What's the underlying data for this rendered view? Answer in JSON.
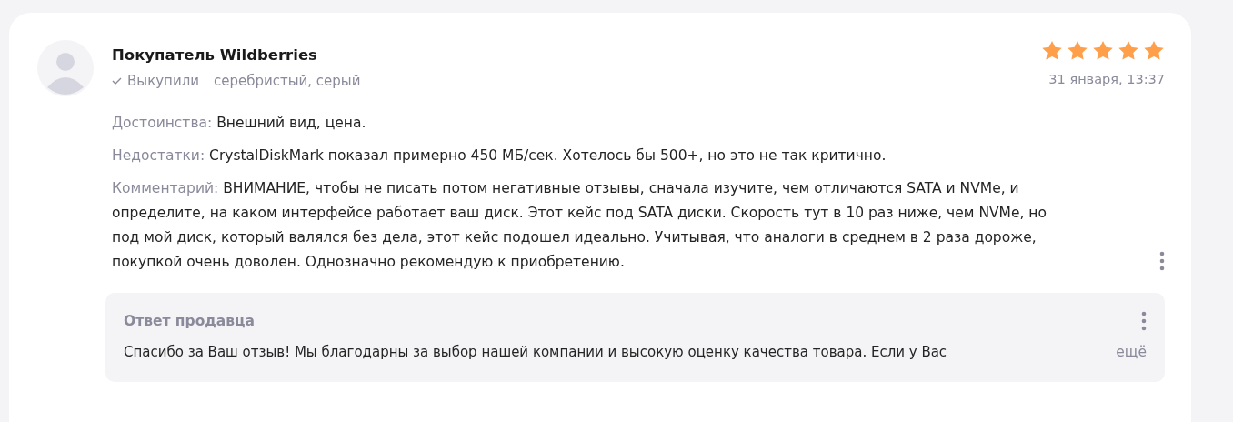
{
  "review": {
    "author": "Покупатель Wildberries",
    "status": "Выкупили",
    "variant": "серебристый, серый",
    "stars": 5,
    "date": "31 января, 13:37",
    "sections": [
      {
        "label": "Достоинства:",
        "text": "Внешний вид, цена."
      },
      {
        "label": "Недостатки:",
        "text": "CrystalDiskMark показал примерно 450 МБ/сек. Хотелось бы 500+, но это не так критично."
      },
      {
        "label": "Комментарий:",
        "text": "ВНИМАНИЕ, чтобы не писать потом негативные отзывы, сначала изучите, чем отличаются SATA и NVMe, и определите, на каком интерфейсе работает ваш диск. Этот кейс под SATA диски. Скорость тут в 10 раз ниже, чем NVMe, но под мой диск, который валялся без дела, этот кейс подошел идеально. Учитывая, что аналоги в среднем в 2 раза дороже, покупкой очень доволен. Однозначно рекомендую к приобретению."
      }
    ],
    "seller_reply": {
      "title": "Ответ продавца",
      "text": "Спасибо за Ваш отзыв! Мы благодарны за выбор нашей компании и высокую оценку качества товара. Если у Вас",
      "more": "ещё"
    }
  }
}
